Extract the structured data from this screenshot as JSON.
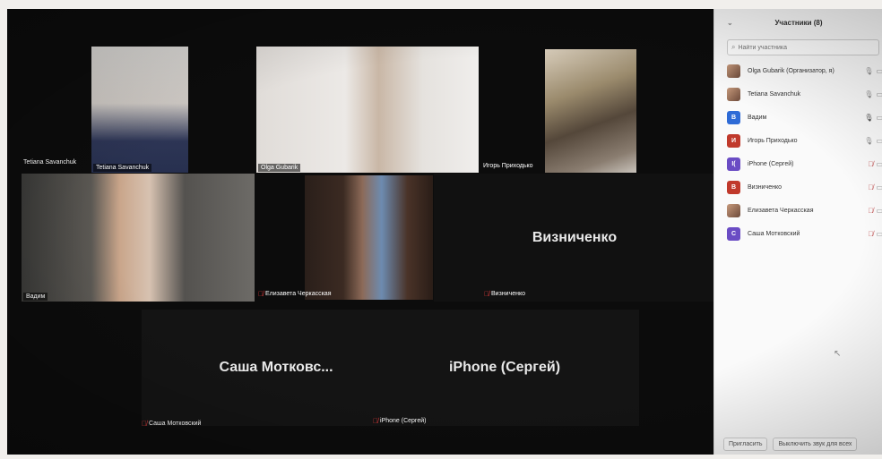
{
  "participants_panel": {
    "title": "Участники (8)",
    "search_placeholder": "Найти участника",
    "invite_label": "Пригласить",
    "mute_all_label": "Выключить звук для всех",
    "items": [
      {
        "name": "Olga Gubarik (Организатор, я)",
        "avatar_letter": "",
        "avatar_color": "photo",
        "mic": "on"
      },
      {
        "name": "Tetiana Savanchuk",
        "avatar_letter": "",
        "avatar_color": "photo",
        "mic": "on"
      },
      {
        "name": "Вадим",
        "avatar_letter": "В",
        "avatar_color": "#2e6bd6",
        "mic": "on"
      },
      {
        "name": "Игорь Приходько",
        "avatar_letter": "И",
        "avatar_color": "#c0392b",
        "mic": "on"
      },
      {
        "name": "iPhone (Сергей)",
        "avatar_letter": "I(",
        "avatar_color": "#6a4cc4",
        "mic": "off"
      },
      {
        "name": "Визниченко",
        "avatar_letter": "В",
        "avatar_color": "#c0392b",
        "mic": "off"
      },
      {
        "name": "Елизавета Черкасская",
        "avatar_letter": "",
        "avatar_color": "photo",
        "mic": "off"
      },
      {
        "name": "Саша Мотковский",
        "avatar_letter": "С",
        "avatar_color": "#6a4cc4",
        "mic": "off"
      }
    ]
  },
  "gallery": {
    "tiles": [
      {
        "name": "Tetiana Savanchuk"
      },
      {
        "name": "Olga Gubarik"
      },
      {
        "name": "Игорь Приходько"
      },
      {
        "name": "Вадим"
      },
      {
        "name": "Елизавета Черкасская"
      },
      {
        "name": "Визниченко",
        "display": "Визниченко"
      },
      {
        "name": "Саша Мотковский",
        "display": "Саша  Мотковс..."
      },
      {
        "name": "iPhone (Сергей)",
        "display": "iPhone (Сергей)"
      }
    ]
  },
  "icons": {
    "mic": "microphone-icon",
    "mic_off": "microphone-off-icon",
    "video": "video-camera-icon",
    "search": "search-icon",
    "collapse": "chevron-down-icon"
  },
  "colors": {
    "active_speaker_border": "#bfd65f",
    "panel_bg": "#fafafa",
    "muted": "#e23b3b"
  }
}
